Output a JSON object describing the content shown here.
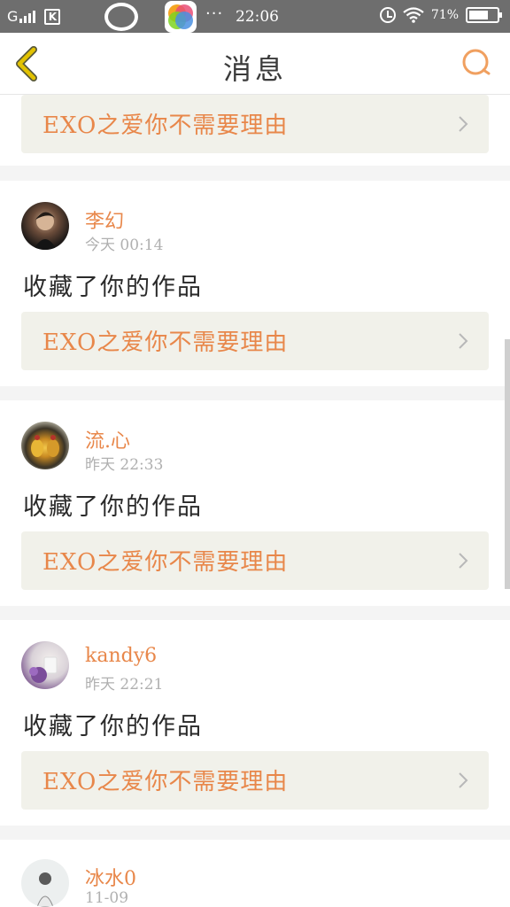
{
  "status_bar": {
    "carrier": "G",
    "k_icon": "K",
    "dots": "···",
    "time": "22:06",
    "battery_text": "71%",
    "battery_level": 0.71,
    "icons": [
      "signal-icon",
      "k-app-icon",
      "circle-app-icon",
      "colorful-app-icon",
      "alarm-icon",
      "wifi-icon",
      "battery-icon"
    ]
  },
  "nav": {
    "title": "消息",
    "back_icon": "chevron-left-icon",
    "search_icon": "search-icon"
  },
  "colors": {
    "accent": "#e8874a",
    "back_icon": "#e2c200",
    "work_bar_bg": "#f1f1ea"
  },
  "top_work": {
    "title": "EXO之爱你不需要理由"
  },
  "messages": [
    {
      "username": "李幻",
      "time": "今天 00:14",
      "action": "收藏了你的作品",
      "work_title": "EXO之爱你不需要理由"
    },
    {
      "username": "流.心",
      "time": "昨天 22:33",
      "action": "收藏了你的作品",
      "work_title": "EXO之爱你不需要理由"
    },
    {
      "username": "kandy6",
      "time": "昨天 22:21",
      "action": "收藏了你的作品",
      "work_title": "EXO之爱你不需要理由"
    },
    {
      "username": "冰水0",
      "time": "11-09"
    }
  ]
}
